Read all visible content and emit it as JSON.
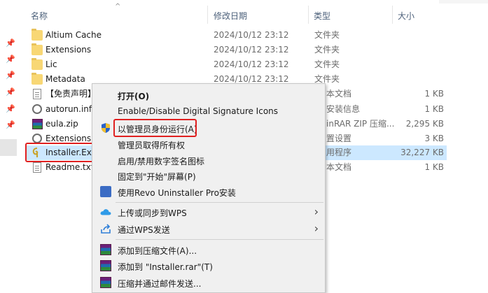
{
  "columns": {
    "name": "名称",
    "date": "修改日期",
    "type": "类型",
    "size": "大小"
  },
  "files": [
    {
      "name": "Altium Cache",
      "date": "2024/10/12 23:12",
      "type": "文件夹",
      "size": "",
      "icon": "folder-icon"
    },
    {
      "name": "Extensions",
      "date": "2024/10/12 23:12",
      "type": "文件夹",
      "size": "",
      "icon": "folder-icon"
    },
    {
      "name": "Lic",
      "date": "2024/10/12 23:12",
      "type": "文件夹",
      "size": "",
      "icon": "folder-icon"
    },
    {
      "name": "Metadata",
      "date": "2024/10/12 23:12",
      "type": "文件夹",
      "size": "",
      "icon": "folder-icon"
    },
    {
      "name": "【免责声明】",
      "date": "",
      "type": "本文档",
      "size": "1 KB",
      "icon": "text-document-icon"
    },
    {
      "name": "autorun.inf",
      "date": "",
      "type": "安装信息",
      "size": "1 KB",
      "icon": "setup-info-icon"
    },
    {
      "name": "eula.zip",
      "date": "",
      "type": "inRAR ZIP 压缩...",
      "size": "2,295 KB",
      "icon": "winrar-archive-icon"
    },
    {
      "name": "Extensions.i",
      "date": "",
      "type": "置设置",
      "size": "3 KB",
      "icon": "settings-file-icon"
    },
    {
      "name": "Installer.Exe",
      "date": "",
      "type": "用程序",
      "size": "32,227 KB",
      "icon": "installer-app-icon"
    },
    {
      "name": "Readme.txt",
      "date": "",
      "type": "本文档",
      "size": "1 KB",
      "icon": "text-document-icon"
    }
  ],
  "context_menu": {
    "open": "打开(O)",
    "signature": "Enable/Disable Digital Signature Icons",
    "run_as_admin": "以管理员身份运行(A)",
    "take_ownership": "管理员取得所有权",
    "toggle_signature_cn": "启用/禁用数字签名图标",
    "pin_start": "固定到\"开始\"屏幕(P)",
    "revo": "使用Revo Uninstaller Pro安装",
    "upload_wps": "上传或同步到WPS",
    "send_wps": "通过WPS发送",
    "add_archive": "添加到压缩文件(A)...",
    "add_rar": "添加到 \"Installer.rar\"(T)",
    "compress_email": "压缩并通过邮件发送..."
  },
  "colors": {
    "highlight_box": "#e02020",
    "selected_row": "#cce8ff",
    "header_text": "#4c607a",
    "folder": "#f8d775"
  }
}
